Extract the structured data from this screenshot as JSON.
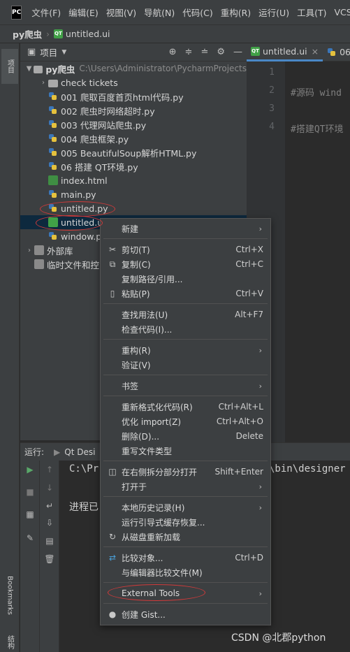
{
  "menubar": {
    "logo": "PC",
    "items": [
      "文件(F)",
      "编辑(E)",
      "视图(V)",
      "导航(N)",
      "代码(C)",
      "重构(R)",
      "运行(U)",
      "工具(T)",
      "VCS("
    ]
  },
  "navbar": {
    "project": "py爬虫",
    "file": "untitled.ui"
  },
  "strips": {
    "top": "项目",
    "bookmarks": "Bookmarks",
    "structure": "结构"
  },
  "project_panel": {
    "title": "项目"
  },
  "tree": {
    "root": {
      "name": "py爬虫",
      "path": "C:\\Users\\Administrator\\PycharmProjects"
    },
    "items": [
      {
        "name": "check tickets",
        "type": "folder"
      },
      {
        "name": "001 爬取百度首页html代码.py",
        "type": "py"
      },
      {
        "name": "002 爬虫时网络超时.py",
        "type": "py"
      },
      {
        "name": "003 代理网站爬虫.py",
        "type": "py"
      },
      {
        "name": "004 爬虫框架.py",
        "type": "py"
      },
      {
        "name": "005 BeautifulSoup解析HTML.py",
        "type": "py"
      },
      {
        "name": "06 搭建 QT环境.py",
        "type": "py"
      },
      {
        "name": "index.html",
        "type": "html"
      },
      {
        "name": "main.py",
        "type": "py"
      },
      {
        "name": "untitled.py",
        "type": "py"
      },
      {
        "name": "untitled.ui",
        "type": "qt"
      },
      {
        "name": "window.p",
        "type": "py"
      }
    ],
    "external_libs": "外部库",
    "scratches": "临时文件和控"
  },
  "editor": {
    "tabs": [
      "untitled.ui",
      "06"
    ],
    "line_numbers": [
      "1",
      "2",
      "3",
      "4"
    ],
    "lines": [
      "#源码 wind",
      "#搭建QT环境"
    ]
  },
  "run": {
    "label": "运行:",
    "tab": "Qt Desi",
    "console": [
      "C:\\Pr",
      "\\bin\\designer",
      "进程已"
    ]
  },
  "context_menu": {
    "items": [
      {
        "label": "新建",
        "shortcut": "",
        "submenu": true,
        "icon": ""
      },
      {
        "label": "剪切(T)",
        "shortcut": "Ctrl+X",
        "submenu": false,
        "icon": "scissors-icon"
      },
      {
        "label": "复制(C)",
        "shortcut": "Ctrl+C",
        "submenu": false,
        "icon": "copy-icon"
      },
      {
        "label": "复制路径/引用...",
        "shortcut": "",
        "submenu": false,
        "icon": ""
      },
      {
        "label": "粘贴(P)",
        "shortcut": "Ctrl+V",
        "submenu": false,
        "icon": "paste-icon"
      },
      {
        "label": "查找用法(U)",
        "shortcut": "Alt+F7",
        "submenu": false,
        "icon": ""
      },
      {
        "label": "检查代码(I)...",
        "shortcut": "",
        "submenu": false,
        "icon": ""
      },
      {
        "label": "重构(R)",
        "shortcut": "",
        "submenu": true,
        "icon": ""
      },
      {
        "label": "验证(V)",
        "shortcut": "",
        "submenu": false,
        "icon": ""
      },
      {
        "label": "书签",
        "shortcut": "",
        "submenu": true,
        "icon": ""
      },
      {
        "label": "重新格式化代码(R)",
        "shortcut": "Ctrl+Alt+L",
        "submenu": false,
        "icon": ""
      },
      {
        "label": "优化 import(Z)",
        "shortcut": "Ctrl+Alt+O",
        "submenu": false,
        "icon": ""
      },
      {
        "label": "删除(D)...",
        "shortcut": "Delete",
        "submenu": false,
        "icon": ""
      },
      {
        "label": "重写文件类型",
        "shortcut": "",
        "submenu": false,
        "icon": ""
      },
      {
        "label": "在右侧拆分部分打开",
        "shortcut": "Shift+Enter",
        "submenu": false,
        "icon": "split-icon"
      },
      {
        "label": "打开于",
        "shortcut": "",
        "submenu": true,
        "icon": ""
      },
      {
        "label": "本地历史记录(H)",
        "shortcut": "",
        "submenu": true,
        "icon": ""
      },
      {
        "label": "运行引导式缓存恢复...",
        "shortcut": "",
        "submenu": false,
        "icon": ""
      },
      {
        "label": "从磁盘重新加载",
        "shortcut": "",
        "submenu": false,
        "icon": "reload-icon"
      },
      {
        "label": "比较对象...",
        "shortcut": "Ctrl+D",
        "submenu": false,
        "icon": "compare-icon"
      },
      {
        "label": "与编辑器比较文件(M)",
        "shortcut": "",
        "submenu": false,
        "icon": ""
      },
      {
        "label": "External Tools",
        "shortcut": "",
        "submenu": true,
        "icon": ""
      },
      {
        "label": "创建 Gist...",
        "shortcut": "",
        "submenu": false,
        "icon": "github-icon"
      }
    ]
  },
  "watermark": "CSDN @北郡python",
  "colors": {
    "annotation": "#d23a3a",
    "selection": "#0d293e",
    "accent": "#4a88c7"
  }
}
